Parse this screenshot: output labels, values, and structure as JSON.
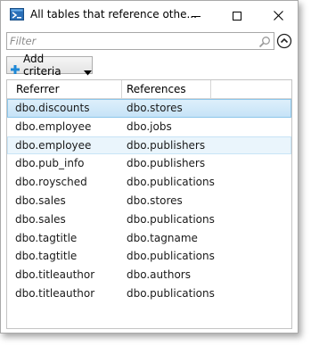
{
  "window": {
    "title": "All tables that reference othe...",
    "icon": "powershell-app-icon",
    "minimize_icon": "minimize-icon",
    "maximize_icon": "maximize-icon",
    "close_icon": "close-icon"
  },
  "filter": {
    "placeholder": "Filter",
    "value": "",
    "search_icon": "search-icon",
    "collapse_icon": "chevron-up-circle-icon"
  },
  "toolbar": {
    "add_criteria_label": "Add criteria",
    "plus_icon": "plus-icon",
    "dropdown_icon": "dropdown-arrow-icon"
  },
  "grid": {
    "columns": [
      "Referrer",
      "References",
      ""
    ],
    "rows": [
      {
        "referrer": "dbo.discounts",
        "references": "dbo.stores",
        "state": "selected"
      },
      {
        "referrer": "dbo.employee",
        "references": "dbo.jobs",
        "state": ""
      },
      {
        "referrer": "dbo.employee",
        "references": "dbo.publishers",
        "state": "hover"
      },
      {
        "referrer": "dbo.pub_info",
        "references": "dbo.publishers",
        "state": ""
      },
      {
        "referrer": "dbo.roysched",
        "references": "dbo.publications",
        "state": ""
      },
      {
        "referrer": "dbo.sales",
        "references": "dbo.stores",
        "state": ""
      },
      {
        "referrer": "dbo.sales",
        "references": "dbo.publications",
        "state": ""
      },
      {
        "referrer": "dbo.tagtitle",
        "references": "dbo.tagname",
        "state": ""
      },
      {
        "referrer": "dbo.tagtitle",
        "references": "dbo.publications",
        "state": ""
      },
      {
        "referrer": "dbo.titleauthor",
        "references": "dbo.authors",
        "state": ""
      },
      {
        "referrer": "dbo.titleauthor",
        "references": "dbo.publications",
        "state": ""
      }
    ]
  },
  "colors": {
    "selected_row": "#c6e3f7",
    "selected_border": "#8cc6ea",
    "hover_row": "#eaf5fc",
    "accent": "#1e88d6"
  }
}
